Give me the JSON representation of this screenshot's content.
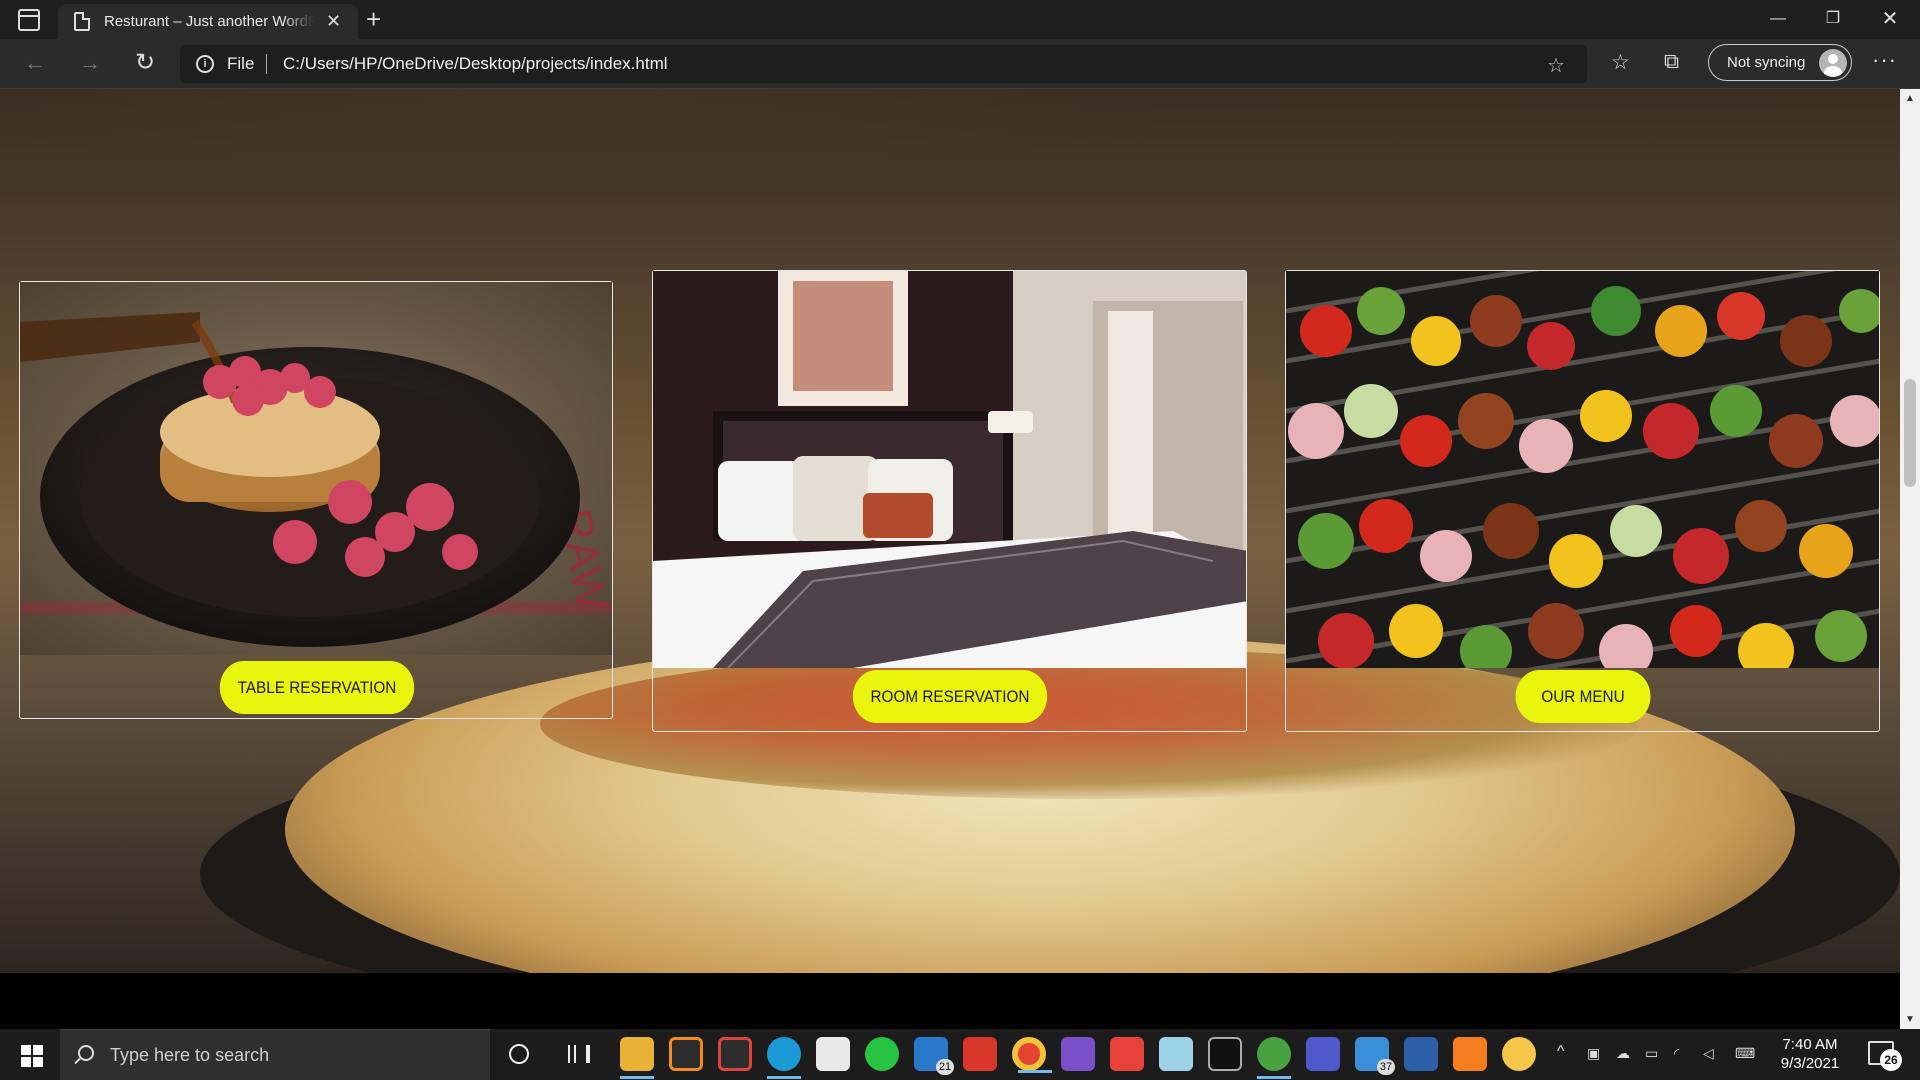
{
  "browser": {
    "tab_title": "Resturant – Just another WordPress site",
    "tab_close": "✕",
    "new_tab": "+",
    "win_minimize": "—",
    "win_restore": "❐",
    "win_close": "✕",
    "back": "←",
    "forward": "→",
    "reload": "↻",
    "info": "i",
    "scheme_label": "File",
    "url": "C:/Users/HP/OneDrive/Desktop/projects/index.html",
    "add_favorite": "☆",
    "favorites": "☆",
    "collections": "⧉",
    "sync_label": "Not syncing",
    "more": "···"
  },
  "page": {
    "cards": [
      {
        "button": "TABLE RESERVATION"
      },
      {
        "button": "ROOM RESERVATION"
      },
      {
        "button": "OUR MENU"
      }
    ]
  },
  "taskbar": {
    "search_placeholder": "Type here to search",
    "mail_badge": "21",
    "files_badge": "37",
    "tray_arrow": "^",
    "time": "7:40 AM",
    "date": "9/3/2021",
    "notifications_count": "26"
  },
  "colors": {
    "button_accent": "#e9f50c",
    "edge_accent": "#76b9ed"
  }
}
